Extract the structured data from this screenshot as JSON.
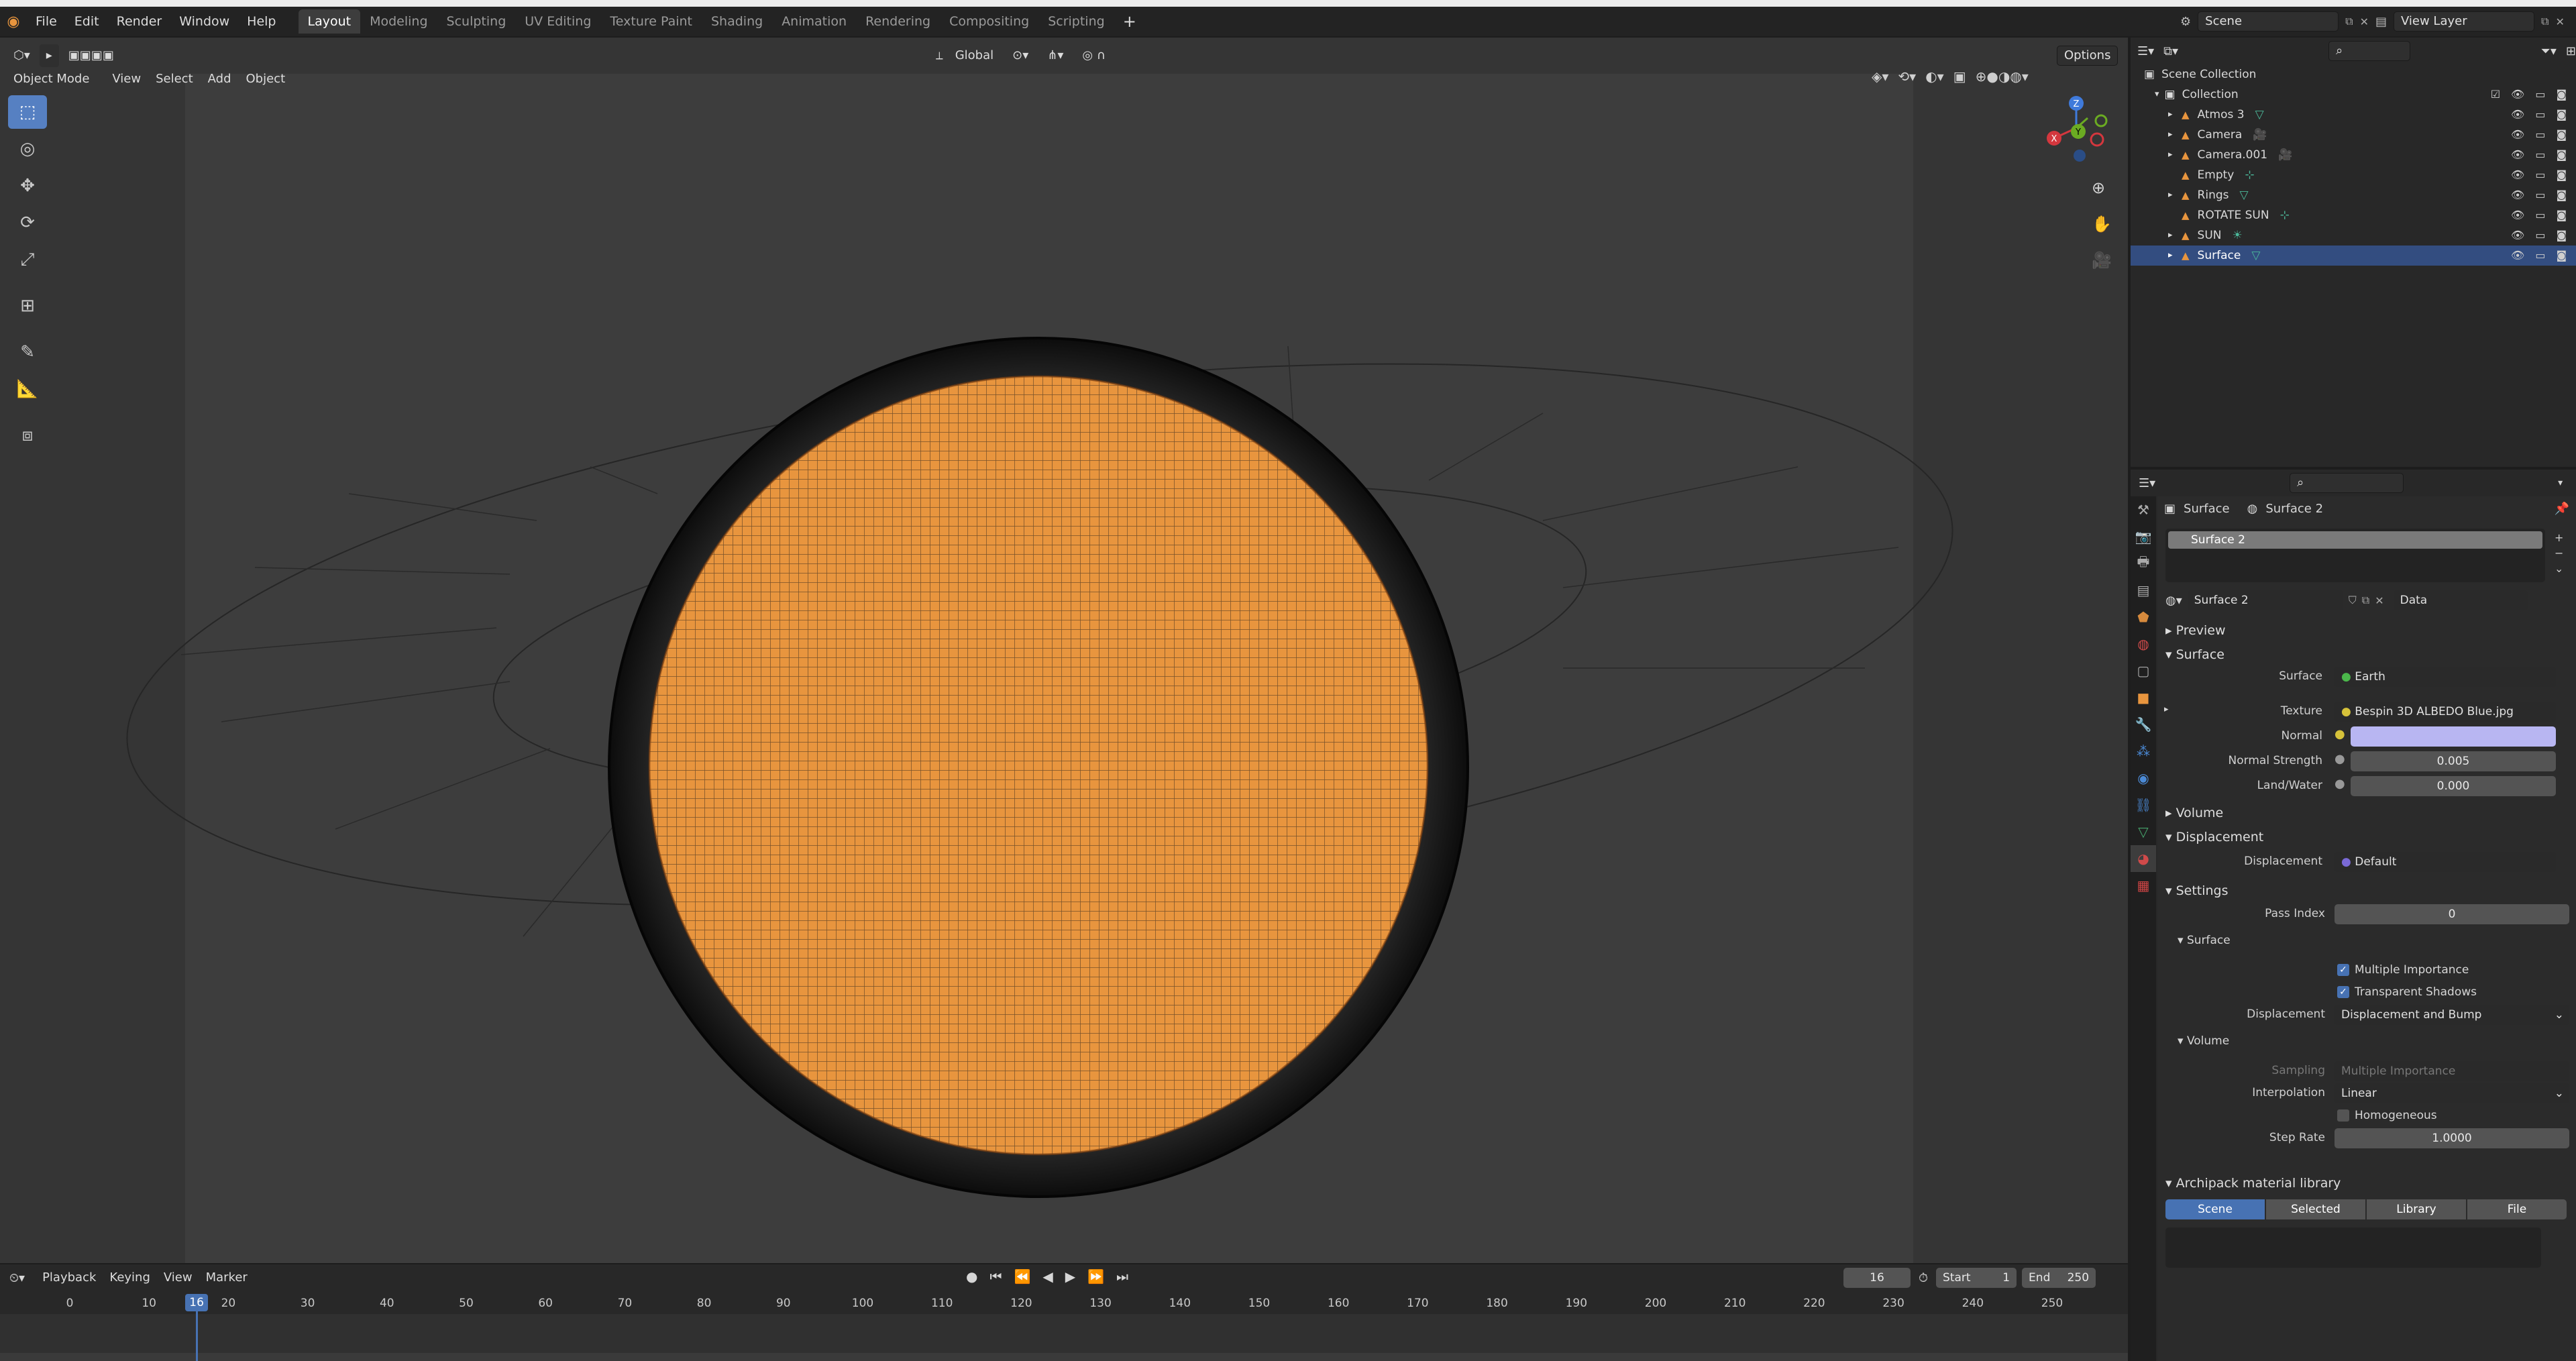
{
  "menus": [
    "File",
    "Edit",
    "Render",
    "Window",
    "Help"
  ],
  "workspaces": [
    "Layout",
    "Modeling",
    "Sculpting",
    "UV Editing",
    "Texture Paint",
    "Shading",
    "Animation",
    "Rendering",
    "Compositing",
    "Scripting"
  ],
  "active_workspace": "Layout",
  "add_workspace_icon": "+",
  "scene": {
    "name": "Scene",
    "view_layer": "View Layer"
  },
  "viewport": {
    "mode": "Object Mode",
    "menus": [
      "View",
      "Select",
      "Add",
      "Object"
    ],
    "orientation": "Global",
    "options_label": "Options",
    "gizmo": {
      "x": "X",
      "y": "Y",
      "z": "Z"
    },
    "tools": [
      "select-box-icon",
      "cursor-icon",
      "move-icon",
      "rotate-icon",
      "scale-icon",
      "transform-icon",
      "annotate-icon",
      "measure-icon",
      "add-cube-icon"
    ]
  },
  "outliner": {
    "root": "Scene Collection",
    "collection": "Collection",
    "items": [
      {
        "name": "Atmos 3",
        "color": "#e8953e"
      },
      {
        "name": "Camera",
        "color": "#e8953e"
      },
      {
        "name": "Camera.001",
        "color": "#e8953e"
      },
      {
        "name": "Empty",
        "color": "#e8953e"
      },
      {
        "name": "Rings",
        "color": "#e8953e"
      },
      {
        "name": "ROTATE SUN",
        "color": "#e8953e"
      },
      {
        "name": "SUN",
        "color": "#e8953e"
      },
      {
        "name": "Surface",
        "color": "#e8953e",
        "selected": true
      }
    ]
  },
  "properties": {
    "breadcrumb_object": "Surface",
    "breadcrumb_material": "Surface 2",
    "slot": "Surface 2",
    "material_name": "Surface 2",
    "link_mode": "Data",
    "sections": {
      "preview": "Preview",
      "surface": "Surface",
      "volume": "Volume",
      "displacement": "Displacement",
      "settings": "Settings",
      "archipack": "Archipack material library"
    },
    "surface": {
      "surface_label": "Surface",
      "surface_value": "Earth",
      "texture_label": "Texture",
      "texture_value": "Bespin 3D ALBEDO Blue.jpg",
      "normal_label": "Normal",
      "normal_strength_label": "Normal Strength",
      "normal_strength_value": "0.005",
      "landwater_label": "Land/Water",
      "landwater_value": "0.000"
    },
    "displacement": {
      "label": "Displacement",
      "value": "Default"
    },
    "settings": {
      "pass_index_label": "Pass Index",
      "pass_index_value": "0",
      "sub_surface": "Surface",
      "multiple_importance": "Multiple Importance",
      "transparent_shadows": "Transparent Shadows",
      "displacement_label": "Displacement",
      "displacement_value": "Displacement and Bump",
      "sub_volume": "Volume",
      "sampling_label": "Sampling",
      "sampling_value": "Multiple Importance",
      "interpolation_label": "Interpolation",
      "interpolation_value": "Linear",
      "homogeneous": "Homogeneous",
      "step_rate_label": "Step Rate",
      "step_rate_value": "1.0000"
    },
    "archipack_tabs": [
      "Scene",
      "Selected",
      "Library",
      "File"
    ],
    "normal_color": "#b8b6f2"
  },
  "timeline": {
    "menus": [
      "Playback",
      "Keying",
      "View",
      "Marker"
    ],
    "current_frame": "16",
    "start_label": "Start",
    "start_value": "1",
    "end_label": "End",
    "end_value": "250",
    "ticks": [
      "0",
      "10",
      "20",
      "30",
      "40",
      "50",
      "60",
      "70",
      "80",
      "90",
      "100",
      "110",
      "120",
      "130",
      "140",
      "150",
      "160",
      "170",
      "180",
      "190",
      "200",
      "210",
      "220",
      "230",
      "240",
      "250"
    ]
  },
  "colors": {
    "accent": "#4772b3",
    "selection": "#334d80",
    "sphere": "#e8953e"
  }
}
